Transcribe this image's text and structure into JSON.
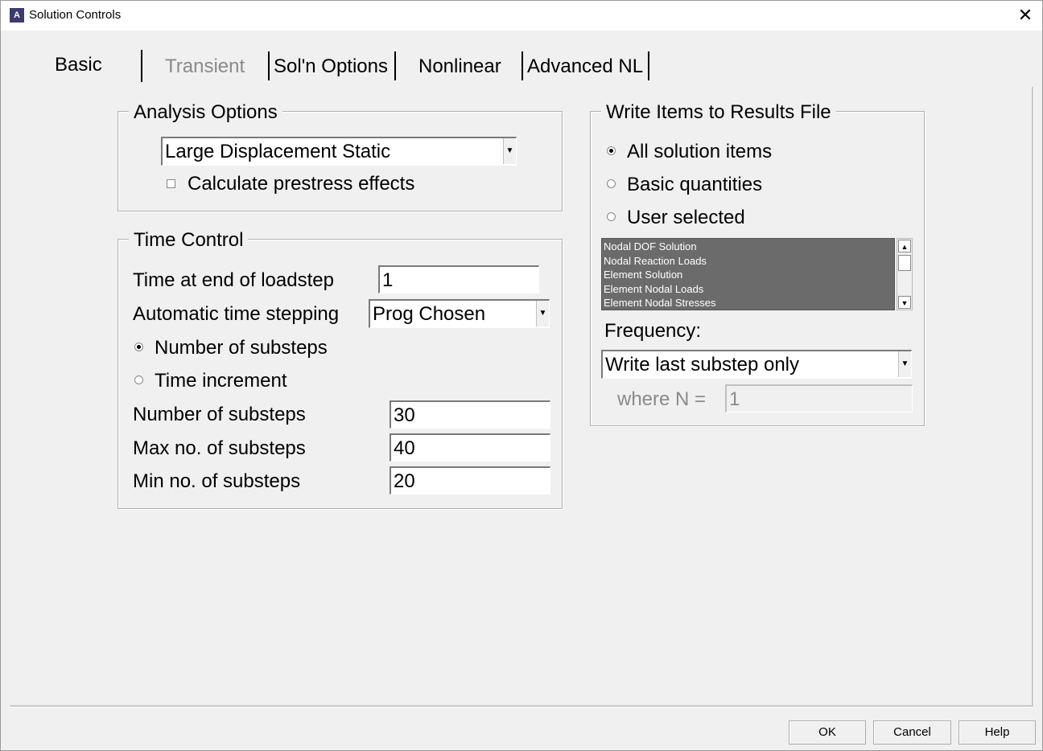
{
  "window": {
    "title": "Solution Controls",
    "close_glyph": "✕",
    "app_icon_letter": "A"
  },
  "tabs": [
    {
      "label": "Basic",
      "state": "active"
    },
    {
      "label": "Transient",
      "state": "disabled"
    },
    {
      "label": "Sol'n Options",
      "state": "normal"
    },
    {
      "label": "Nonlinear",
      "state": "normal"
    },
    {
      "label": "Advanced NL",
      "state": "normal"
    }
  ],
  "analysis_options": {
    "title": "Analysis Options",
    "analysis_type": "Large Displacement Static",
    "prestress_label": "Calculate prestress effects",
    "prestress_checked": false
  },
  "time_control": {
    "title": "Time Control",
    "time_end_label": "Time at end of loadstep",
    "time_end_value": "1",
    "auto_step_label": "Automatic time stepping",
    "auto_step_value": "Prog Chosen",
    "radio_substeps_label": "Number of substeps",
    "radio_increment_label": "Time increment",
    "selected_radio": "substeps",
    "num_substeps_label": "Number of substeps",
    "num_substeps_value": "30",
    "max_substeps_label": "Max no. of substeps",
    "max_substeps_value": "40",
    "min_substeps_label": "Min no. of substeps",
    "min_substeps_value": "20"
  },
  "results_file": {
    "title": "Write Items to Results File",
    "radio_all_label": "All solution items",
    "radio_basic_label": "Basic quantities",
    "radio_user_label": "User selected",
    "selected_radio": "all",
    "items": [
      "Nodal DOF Solution",
      "Nodal Reaction Loads",
      "Element Solution",
      "Element Nodal Loads",
      "Element Nodal Stresses"
    ],
    "frequency_label": "Frequency:",
    "frequency_value": "Write last substep only",
    "where_n_label": "where N =",
    "where_n_value": "1"
  },
  "buttons": {
    "ok": "OK",
    "cancel": "Cancel",
    "help": "Help"
  },
  "icons": {
    "dropdown": "▼",
    "scroll_up": "▲",
    "scroll_down": "▼"
  },
  "colors": {
    "listbox_bg": "#6b6b6b",
    "disabled_text": "#8a8a8a",
    "window_bg": "#f0f0f0"
  }
}
